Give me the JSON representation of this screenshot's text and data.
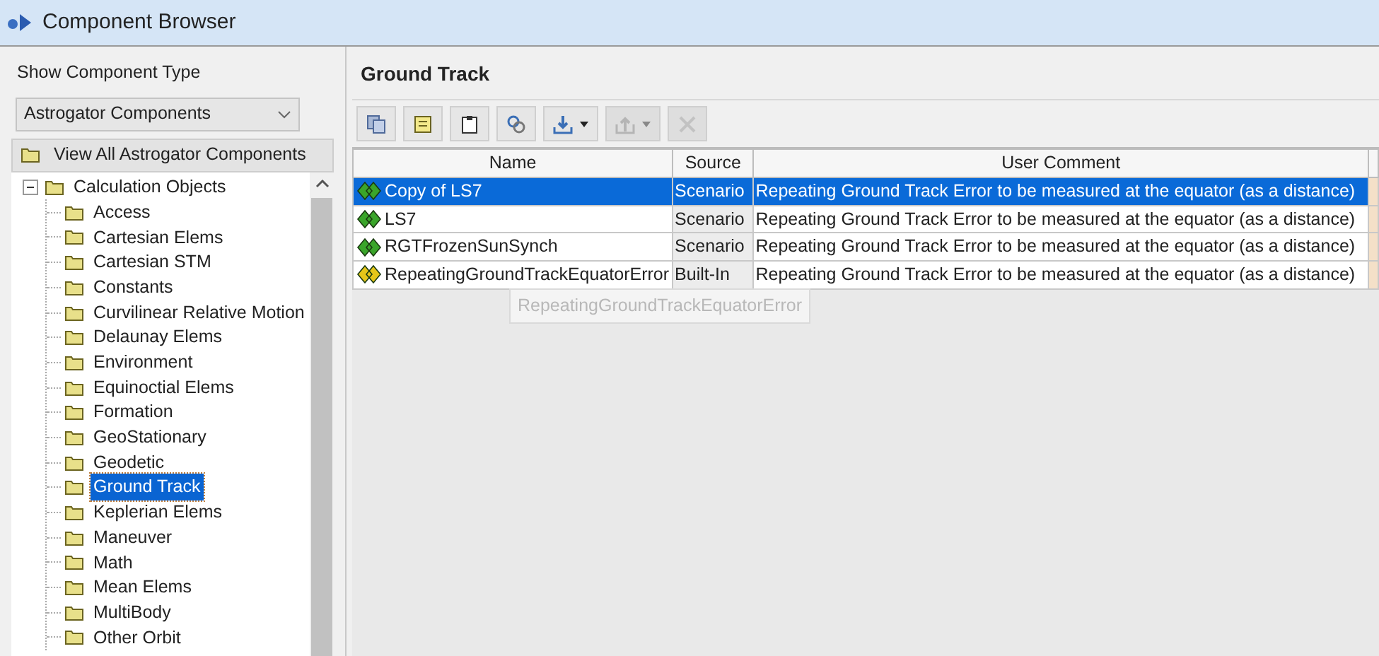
{
  "window": {
    "title": "Component Browser"
  },
  "left_panel": {
    "label": "Show Component Type",
    "dropdown": {
      "value": "Astrogator Components"
    },
    "view_all": "View All Astrogator Components",
    "tree": [
      {
        "label": "Calculation Objects",
        "expanded": true,
        "selected": false,
        "children": [
          {
            "label": "Access",
            "selected": false
          },
          {
            "label": "Cartesian Elems",
            "selected": false
          },
          {
            "label": "Cartesian STM",
            "selected": false
          },
          {
            "label": "Constants",
            "selected": false
          },
          {
            "label": "Curvilinear Relative Motion",
            "selected": false
          },
          {
            "label": "Delaunay Elems",
            "selected": false
          },
          {
            "label": "Environment",
            "selected": false
          },
          {
            "label": "Equinoctial Elems",
            "selected": false
          },
          {
            "label": "Formation",
            "selected": false
          },
          {
            "label": "GeoStationary",
            "selected": false
          },
          {
            "label": "Geodetic",
            "selected": false
          },
          {
            "label": "Ground Track",
            "selected": true
          },
          {
            "label": "Keplerian Elems",
            "selected": false
          },
          {
            "label": "Maneuver",
            "selected": false
          },
          {
            "label": "Math",
            "selected": false
          },
          {
            "label": "Mean Elems",
            "selected": false
          },
          {
            "label": "MultiBody",
            "selected": false
          },
          {
            "label": "Other Orbit",
            "selected": false
          }
        ]
      }
    ]
  },
  "right_panel": {
    "title": "Ground Track",
    "toolbar": [
      {
        "kind": "copy",
        "dropdown": false,
        "disabled": false
      },
      {
        "kind": "note",
        "dropdown": false,
        "disabled": false
      },
      {
        "kind": "paste",
        "dropdown": false,
        "disabled": false
      },
      {
        "kind": "link",
        "dropdown": false,
        "disabled": false
      },
      {
        "kind": "import",
        "dropdown": true,
        "disabled": false
      },
      {
        "kind": "export",
        "dropdown": true,
        "disabled": true
      },
      {
        "kind": "delete",
        "dropdown": false,
        "disabled": true
      }
    ],
    "table": {
      "columns": [
        "Name",
        "Source",
        "User Comment"
      ],
      "rows": [
        {
          "name": "Copy of LS7",
          "source": "Scenario",
          "comment": "Repeating Ground Track Error to be measured at the equator (as a distance)",
          "color": "#3aa52a",
          "selected": true
        },
        {
          "name": "LS7",
          "source": "Scenario",
          "comment": "Repeating Ground Track Error to be measured at the equator (as a distance)",
          "color": "#3aa52a",
          "selected": false
        },
        {
          "name": "RGTFrozenSunSynch",
          "source": "Scenario",
          "comment": "Repeating Ground Track Error to be measured at the equator (as a distance)",
          "color": "#3aa52a",
          "selected": false
        },
        {
          "name": "RepeatingGroundTrackEquatorError",
          "source": "Built-In",
          "comment": "Repeating Ground Track Error to be measured at the equator (as a distance)",
          "color": "#e6c619",
          "selected": false
        }
      ]
    },
    "tooltip": "RepeatingGroundTrackEquatorError"
  }
}
